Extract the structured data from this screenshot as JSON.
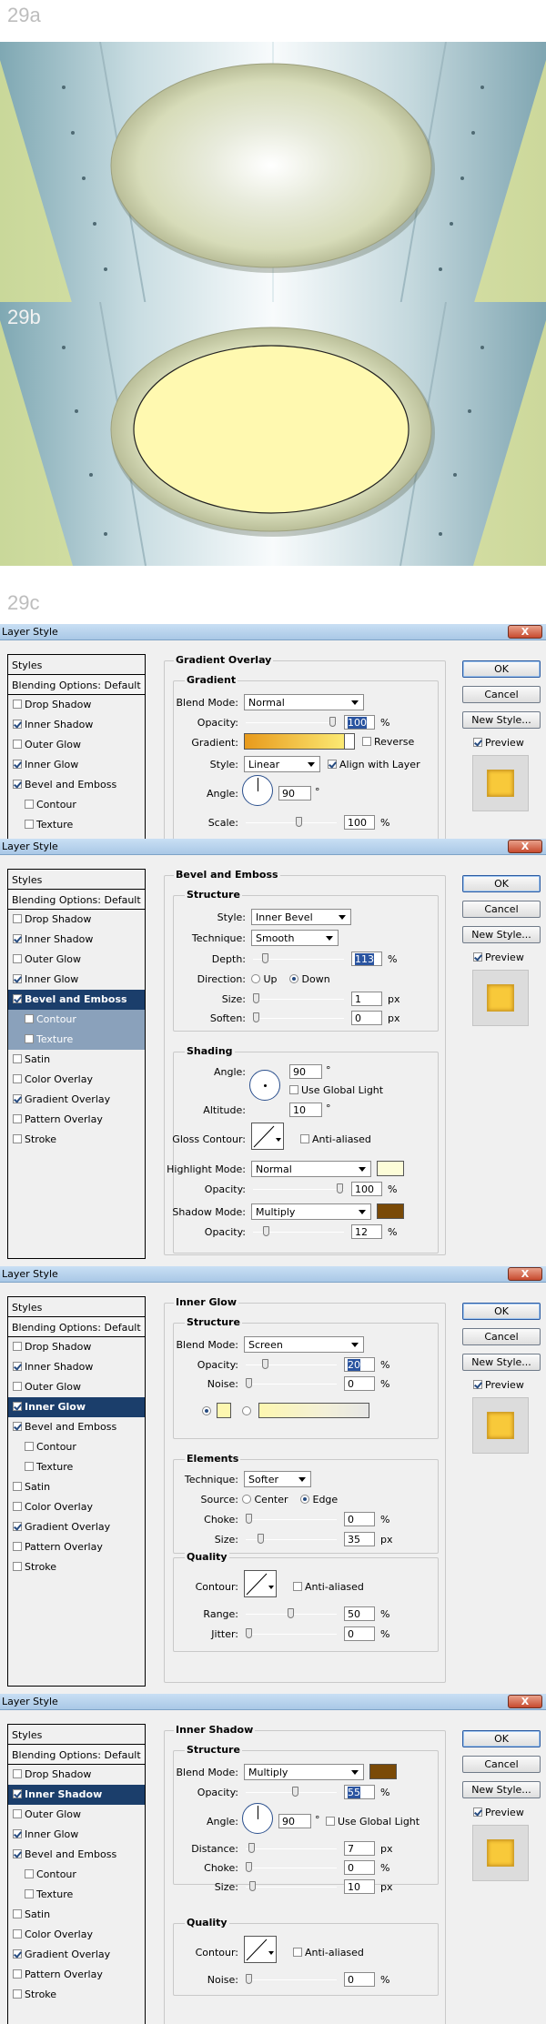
{
  "labels": {
    "a": "29a",
    "b": "29b",
    "c": "29c"
  },
  "colors": {
    "wall": "#dfe8ad",
    "plate_light": "#eaeed0",
    "plate_fill": "#fff9b0",
    "selected": "#1b3e6b",
    "preview": "#f8c93a"
  },
  "common": {
    "window_title": "Layer Style",
    "close_label": "X",
    "styles_header": "Styles",
    "blending_options": "Blending Options: Default",
    "ok": "OK",
    "cancel": "Cancel",
    "new_style": "New Style...",
    "preview": "Preview"
  },
  "style_items": [
    "Drop Shadow",
    "Inner Shadow",
    "Outer Glow",
    "Inner Glow",
    "Bevel and Emboss",
    "Contour",
    "Texture",
    "Satin",
    "Color Overlay",
    "Gradient Overlay",
    "Pattern Overlay",
    "Stroke"
  ],
  "d1": {
    "panel": "Gradient Overlay",
    "group": "Gradient",
    "blend_label": "Blend Mode:",
    "blend_value": "Normal",
    "opacity_label": "Opacity:",
    "opacity_value": "100",
    "pct": "%",
    "gradient_label": "Gradient:",
    "reverse": "Reverse",
    "style_label": "Style:",
    "style_value": "Linear",
    "align": "Align with Layer",
    "angle_label": "Angle:",
    "angle_value": "90",
    "deg": "°",
    "scale_label": "Scale:",
    "scale_value": "100"
  },
  "d2": {
    "panel": "Bevel and Emboss",
    "structure": "Structure",
    "style_label": "Style:",
    "style_value": "Inner Bevel",
    "technique_label": "Technique:",
    "technique_value": "Smooth",
    "depth_label": "Depth:",
    "depth_value": "113",
    "pct": "%",
    "direction_label": "Direction:",
    "up": "Up",
    "down": "Down",
    "size_label": "Size:",
    "size_value": "1",
    "px": "px",
    "soften_label": "Soften:",
    "soften_value": "0",
    "shading": "Shading",
    "angle_label": "Angle:",
    "angle_value": "90",
    "deg": "°",
    "global_light": "Use Global Light",
    "altitude_label": "Altitude:",
    "altitude_value": "10",
    "gloss_label": "Gloss Contour:",
    "anti": "Anti-aliased",
    "hl_label": "Highlight Mode:",
    "hl_value": "Normal",
    "hl_color": "#fdfdd8",
    "hl_op_label": "Opacity:",
    "hl_op_value": "100",
    "sh_label": "Shadow Mode:",
    "sh_value": "Multiply",
    "sh_color": "#7a4a07",
    "sh_op_label": "Opacity:",
    "sh_op_value": "12"
  },
  "d3": {
    "panel": "Inner Glow",
    "structure": "Structure",
    "blend_label": "Blend Mode:",
    "blend_value": "Screen",
    "opacity_label": "Opacity:",
    "opacity_value": "20",
    "pct": "%",
    "noise_label": "Noise:",
    "noise_value": "0",
    "glow_color": "#fdf7b0",
    "elements": "Elements",
    "technique_label": "Technique:",
    "technique_value": "Softer",
    "source_label": "Source:",
    "center": "Center",
    "edge": "Edge",
    "choke_label": "Choke:",
    "choke_value": "0",
    "size_label": "Size:",
    "size_value": "35",
    "px": "px",
    "quality": "Quality",
    "contour_label": "Contour:",
    "anti": "Anti-aliased",
    "range_label": "Range:",
    "range_value": "50",
    "jitter_label": "Jitter:",
    "jitter_value": "0"
  },
  "d4": {
    "panel": "Inner Shadow",
    "structure": "Structure",
    "blend_label": "Blend Mode:",
    "blend_value": "Multiply",
    "color": "#7a4a07",
    "opacity_label": "Opacity:",
    "opacity_value": "55",
    "pct": "%",
    "angle_label": "Angle:",
    "angle_value": "90",
    "deg": "°",
    "global_light": "Use Global Light",
    "distance_label": "Distance:",
    "distance_value": "7",
    "px": "px",
    "choke_label": "Choke:",
    "choke_value": "0",
    "size_label": "Size:",
    "size_value": "10",
    "quality": "Quality",
    "contour_label": "Contour:",
    "anti": "Anti-aliased",
    "noise_label": "Noise:",
    "noise_value": "0"
  },
  "sliders": {
    "d1_opacity": 1.0,
    "d1_scale": 0.6,
    "d2_depth": 0.113,
    "d2_size": 0.0,
    "d2_soften": 0.0,
    "d2_hl_opacity": 1.0,
    "d2_sh_opacity": 0.12,
    "d3_opacity": 0.2,
    "d3_noise": 0.0,
    "d3_choke": 0.0,
    "d3_size": 0.14,
    "d3_range": 0.5,
    "d3_jitter": 0.0,
    "d4_opacity": 0.55,
    "d4_distance": 0.03,
    "d4_choke": 0.0,
    "d4_size": 0.04,
    "d4_noise": 0.0
  }
}
